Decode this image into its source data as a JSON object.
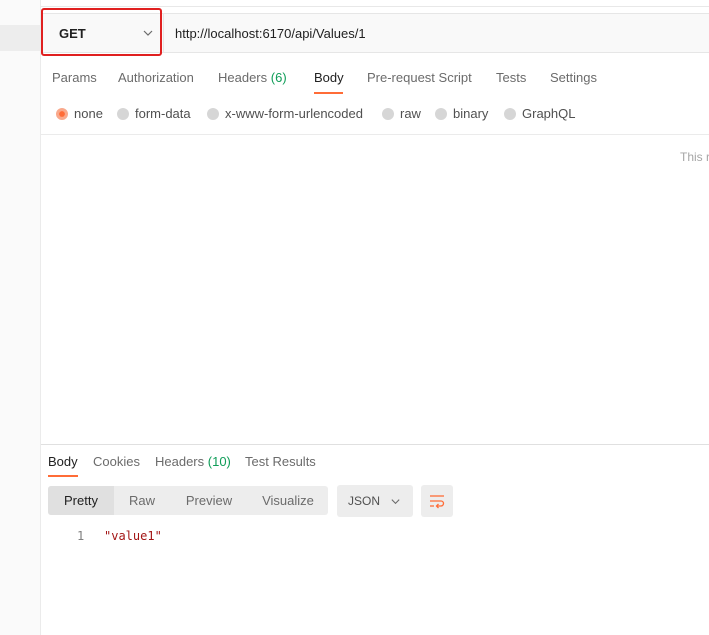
{
  "request": {
    "method": "GET",
    "url": "http://localhost:6170/api/Values/1"
  },
  "request_tabs": [
    {
      "label": "Params"
    },
    {
      "label": "Authorization"
    },
    {
      "label": "Headers",
      "count": "(6)"
    },
    {
      "label": "Body",
      "active": true
    },
    {
      "label": "Pre-request Script"
    },
    {
      "label": "Tests"
    },
    {
      "label": "Settings"
    }
  ],
  "body_types": [
    {
      "label": "none",
      "selected": true
    },
    {
      "label": "form-data"
    },
    {
      "label": "x-www-form-urlencoded"
    },
    {
      "label": "raw"
    },
    {
      "label": "binary"
    },
    {
      "label": "GraphQL"
    }
  ],
  "body_note": "This r",
  "response_tabs": [
    {
      "label": "Body",
      "active": true
    },
    {
      "label": "Cookies"
    },
    {
      "label": "Headers",
      "count": "(10)"
    },
    {
      "label": "Test Results"
    }
  ],
  "view_modes": [
    {
      "label": "Pretty",
      "active": true
    },
    {
      "label": "Raw"
    },
    {
      "label": "Preview"
    },
    {
      "label": "Visualize"
    }
  ],
  "format": "JSON",
  "response_body": {
    "line_number": "1",
    "value": "\"value1\""
  },
  "icons": {
    "method_dropdown": "chevron-down-icon",
    "format_dropdown": "chevron-down-icon",
    "wrap": "wrap-lines-icon"
  },
  "colors": {
    "accent": "#ff6c37",
    "highlight": "#e02020",
    "count": "#0f9d58",
    "string": "#a31515"
  }
}
